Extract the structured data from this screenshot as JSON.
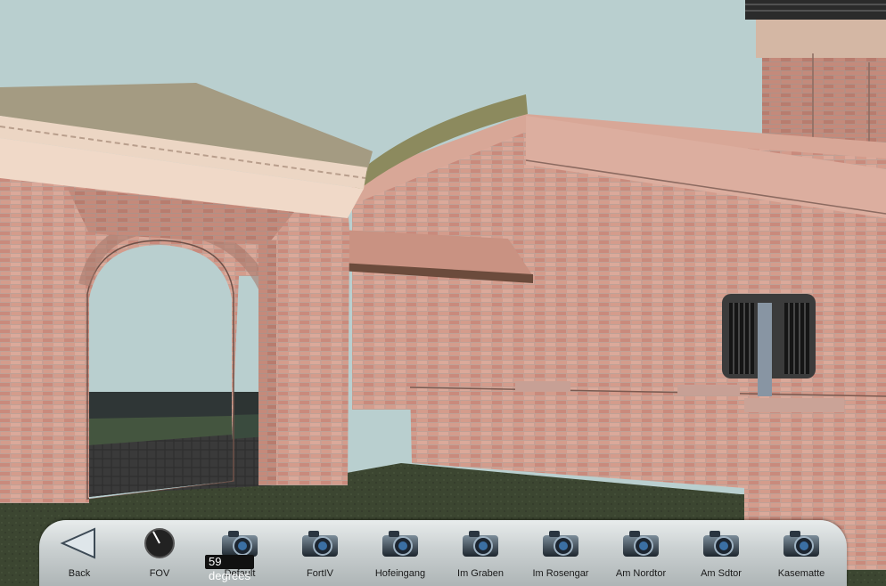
{
  "scene": {
    "sky_color": "#b9cfcf",
    "brick_color": "#d29a8a",
    "grass_color": "#3b4530",
    "roof_color": "#a49b82"
  },
  "toolbar": {
    "back": {
      "label": "Back",
      "icon": "back-arrow-icon"
    },
    "fov": {
      "label": "FOV",
      "value_text": "59 degrees",
      "icon": "knob-icon"
    },
    "cameras": [
      {
        "label": "Default",
        "icon": "camera-icon"
      },
      {
        "label": "FortIV",
        "icon": "camera-icon"
      },
      {
        "label": "Hofeingang",
        "icon": "camera-icon"
      },
      {
        "label": "Im Graben",
        "icon": "camera-icon"
      },
      {
        "label": "Im Rosengar",
        "icon": "camera-icon"
      },
      {
        "label": "Am Nordtor",
        "icon": "camera-icon"
      },
      {
        "label": "Am Sdtor",
        "icon": "camera-icon"
      },
      {
        "label": "Kasematte",
        "icon": "camera-icon"
      }
    ]
  }
}
